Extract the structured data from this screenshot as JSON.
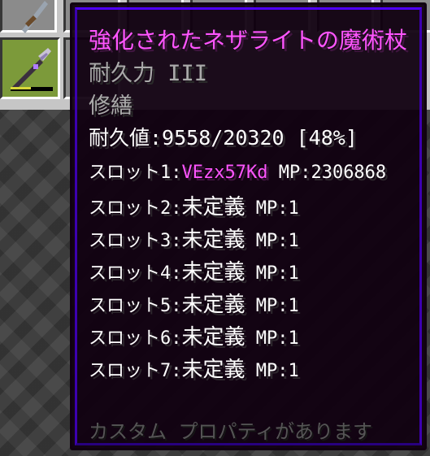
{
  "inventory": {
    "highlighted_slot_item": "netherite-wand-icon",
    "top_slot_item": "pickaxe-icon",
    "durability_fraction": 0.48,
    "colors": {
      "panel": "#c6c6c6",
      "slot": "#8b8b8b",
      "highlight": "#7c9a3a",
      "durability": "#d8d83a"
    }
  },
  "tooltip": {
    "title": "強化されたネザライトの魔術杖",
    "enchantments": [
      "耐久力 III",
      "修繕"
    ],
    "durability_line": "耐久値:9558/20320 [48%]",
    "slots": [
      {
        "label": "スロット1:",
        "value": "VEzx57Kd",
        "mp": "MP:2306868",
        "value_color": "#ff55ff"
      },
      {
        "label": "スロット2:",
        "value": "未定義",
        "mp": "MP:1"
      },
      {
        "label": "スロット3:",
        "value": "未定義",
        "mp": "MP:1"
      },
      {
        "label": "スロット4:",
        "value": "未定義",
        "mp": "MP:1"
      },
      {
        "label": "スロット5:",
        "value": "未定義",
        "mp": "MP:1"
      },
      {
        "label": "スロット6:",
        "value": "未定義",
        "mp": "MP:1"
      },
      {
        "label": "スロット7:",
        "value": "未定義",
        "mp": "MP:1"
      }
    ],
    "footer": "カスタム プロパティがあります",
    "colors": {
      "title": "#ff55ff",
      "enchantment": "#aaaaaa",
      "text": "#ffffff",
      "footer": "#555555",
      "background": "#100010",
      "border": "#5000ff"
    }
  }
}
